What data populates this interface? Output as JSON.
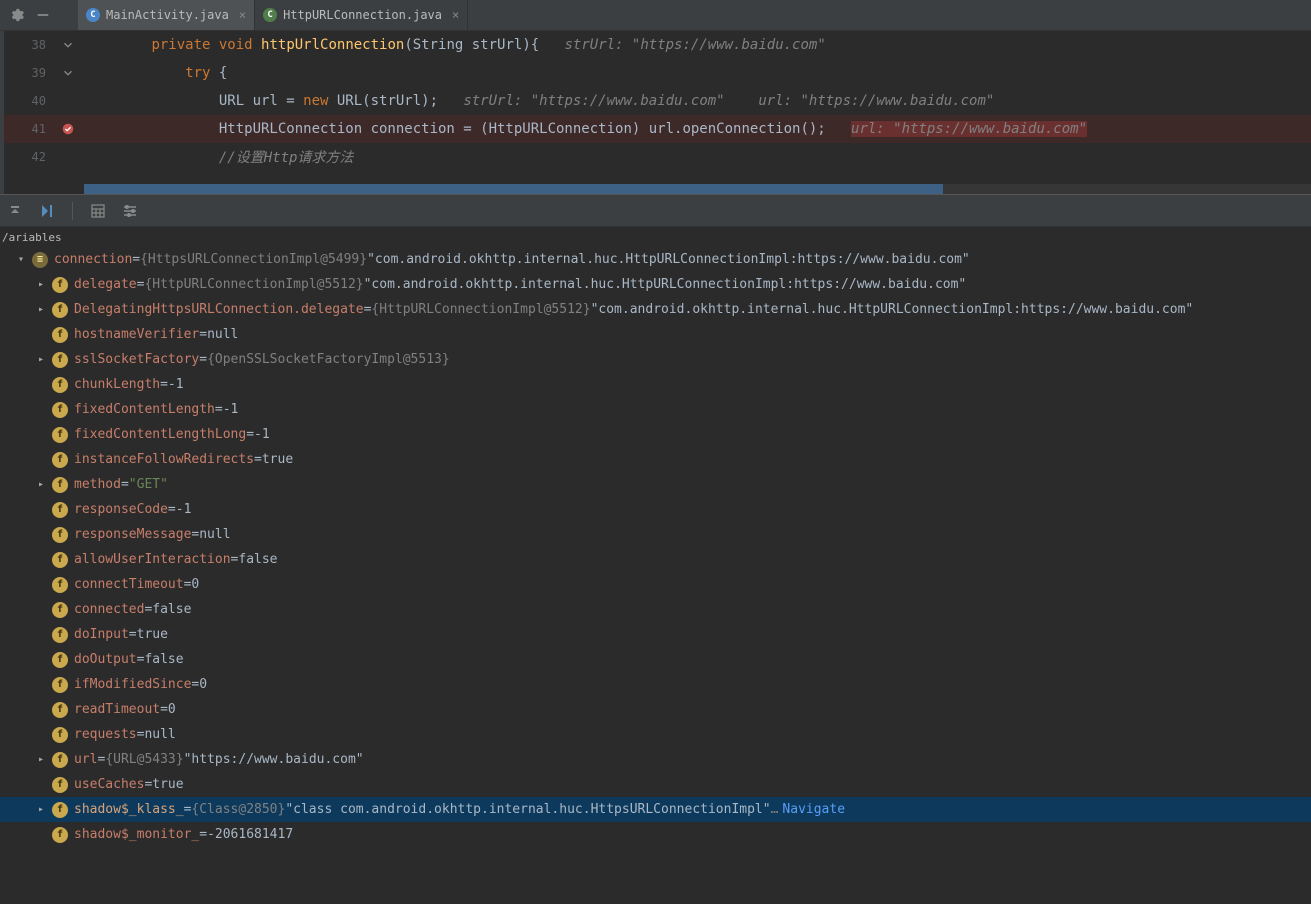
{
  "tabs": [
    {
      "icon_letter": "C",
      "icon_class": "c",
      "label": "MainActivity.java",
      "active": true
    },
    {
      "icon_letter": "C",
      "icon_class": "i",
      "label": "HttpURLConnection.java",
      "active": false
    }
  ],
  "editor": {
    "lines": [
      {
        "num": "38",
        "marker": "collapse",
        "indent": "        ",
        "tokens": [
          {
            "t": "private ",
            "c": "kw"
          },
          {
            "t": "void ",
            "c": "kw"
          },
          {
            "t": "httpUrlConnection",
            "c": "mname"
          },
          {
            "t": "(String strUrl){   ",
            "c": ""
          },
          {
            "t": "strUrl: \"https://www.baidu.com\"",
            "c": "cmt"
          }
        ]
      },
      {
        "num": "39",
        "marker": "collapse",
        "indent": "            ",
        "tokens": [
          {
            "t": "try ",
            "c": "kw"
          },
          {
            "t": "{",
            "c": ""
          }
        ]
      },
      {
        "num": "40",
        "marker": "",
        "indent": "                ",
        "tokens": [
          {
            "t": "URL url = ",
            "c": ""
          },
          {
            "t": "new ",
            "c": "kw"
          },
          {
            "t": "URL(strUrl);   ",
            "c": ""
          },
          {
            "t": "strUrl: \"https://www.baidu.com\"    url: \"https://www.baidu.com\"",
            "c": "cmt"
          }
        ]
      },
      {
        "num": "41",
        "marker": "breakpoint",
        "indent": "                ",
        "bp": true,
        "tokens": [
          {
            "t": "HttpURLConnection connection = (HttpURLConnection) url.openConnection();   ",
            "c": ""
          },
          {
            "t": "url: \"https://www.baidu.com\"",
            "c": "cmt err"
          }
        ]
      },
      {
        "num": "42",
        "marker": "",
        "indent": "                ",
        "tokens": [
          {
            "t": "//设置Http请求方法",
            "c": "cmt"
          }
        ]
      }
    ]
  },
  "vars_label": "/ariables",
  "variables": [
    {
      "indent": 0,
      "exp": "down",
      "icon": "obj",
      "name": "connection",
      "eq": " = ",
      "type": "{HttpsURLConnectionImpl@5499} ",
      "val": "\"com.android.okhttp.internal.huc.HttpURLConnectionImpl:https://www.baidu.com\""
    },
    {
      "indent": 1,
      "exp": "right",
      "icon": "f",
      "name": "delegate",
      "eq": " = ",
      "type": "{HttpURLConnectionImpl@5512} ",
      "val": "\"com.android.okhttp.internal.huc.HttpURLConnectionImpl:https://www.baidu.com\""
    },
    {
      "indent": 1,
      "exp": "right",
      "icon": "f",
      "name": "DelegatingHttpsURLConnection.delegate",
      "eq": " = ",
      "type": "{HttpURLConnectionImpl@5512} ",
      "val": "\"com.android.okhttp.internal.huc.HttpURLConnectionImpl:https://www.baidu.com\""
    },
    {
      "indent": 1,
      "exp": "none",
      "icon": "f",
      "name": "hostnameVerifier",
      "eq": " = ",
      "type": "",
      "val": "null"
    },
    {
      "indent": 1,
      "exp": "right",
      "icon": "f",
      "name": "sslSocketFactory",
      "eq": " = ",
      "type": "{OpenSSLSocketFactoryImpl@5513}",
      "val": ""
    },
    {
      "indent": 1,
      "exp": "none",
      "icon": "f",
      "name": "chunkLength",
      "eq": " = ",
      "type": "",
      "val": "-1"
    },
    {
      "indent": 1,
      "exp": "none",
      "icon": "f",
      "name": "fixedContentLength",
      "eq": " = ",
      "type": "",
      "val": "-1"
    },
    {
      "indent": 1,
      "exp": "none",
      "icon": "f",
      "name": "fixedContentLengthLong",
      "eq": " = ",
      "type": "",
      "val": "-1"
    },
    {
      "indent": 1,
      "exp": "none",
      "icon": "f",
      "name": "instanceFollowRedirects",
      "eq": " = ",
      "type": "",
      "val": "true"
    },
    {
      "indent": 1,
      "exp": "right",
      "icon": "f",
      "name": "method",
      "eq": " = ",
      "type": "",
      "val": "\"GET\"",
      "str": true
    },
    {
      "indent": 1,
      "exp": "none",
      "icon": "f",
      "name": "responseCode",
      "eq": " = ",
      "type": "",
      "val": "-1"
    },
    {
      "indent": 1,
      "exp": "none",
      "icon": "f",
      "name": "responseMessage",
      "eq": " = ",
      "type": "",
      "val": "null"
    },
    {
      "indent": 1,
      "exp": "none",
      "icon": "f",
      "name": "allowUserInteraction",
      "eq": " = ",
      "type": "",
      "val": "false"
    },
    {
      "indent": 1,
      "exp": "none",
      "icon": "f",
      "name": "connectTimeout",
      "eq": " = ",
      "type": "",
      "val": "0"
    },
    {
      "indent": 1,
      "exp": "none",
      "icon": "f",
      "name": "connected",
      "eq": " = ",
      "type": "",
      "val": "false"
    },
    {
      "indent": 1,
      "exp": "none",
      "icon": "f",
      "name": "doInput",
      "eq": " = ",
      "type": "",
      "val": "true"
    },
    {
      "indent": 1,
      "exp": "none",
      "icon": "f",
      "name": "doOutput",
      "eq": " = ",
      "type": "",
      "val": "false"
    },
    {
      "indent": 1,
      "exp": "none",
      "icon": "f",
      "name": "ifModifiedSince",
      "eq": " = ",
      "type": "",
      "val": "0"
    },
    {
      "indent": 1,
      "exp": "none",
      "icon": "f",
      "name": "readTimeout",
      "eq": " = ",
      "type": "",
      "val": "0"
    },
    {
      "indent": 1,
      "exp": "none",
      "icon": "f",
      "name": "requests",
      "eq": " = ",
      "type": "",
      "val": "null"
    },
    {
      "indent": 1,
      "exp": "right",
      "icon": "f",
      "name": "url",
      "eq": " = ",
      "type": "{URL@5433} ",
      "val": "\"https://www.baidu.com\""
    },
    {
      "indent": 1,
      "exp": "none",
      "icon": "f",
      "name": "useCaches",
      "eq": " = ",
      "type": "",
      "val": "true"
    },
    {
      "indent": 1,
      "exp": "right",
      "icon": "f",
      "name": "shadow$_klass_",
      "eq": " = ",
      "type": "{Class@2850} ",
      "val": "\"class com.android.okhttp.internal.huc.HttpsURLConnectionImpl\"",
      "trail": "…",
      "link": "Navigate",
      "selected": true
    },
    {
      "indent": 1,
      "exp": "none",
      "icon": "f",
      "name": "shadow$_monitor_",
      "eq": " = ",
      "type": "",
      "val": "-2061681417"
    }
  ]
}
